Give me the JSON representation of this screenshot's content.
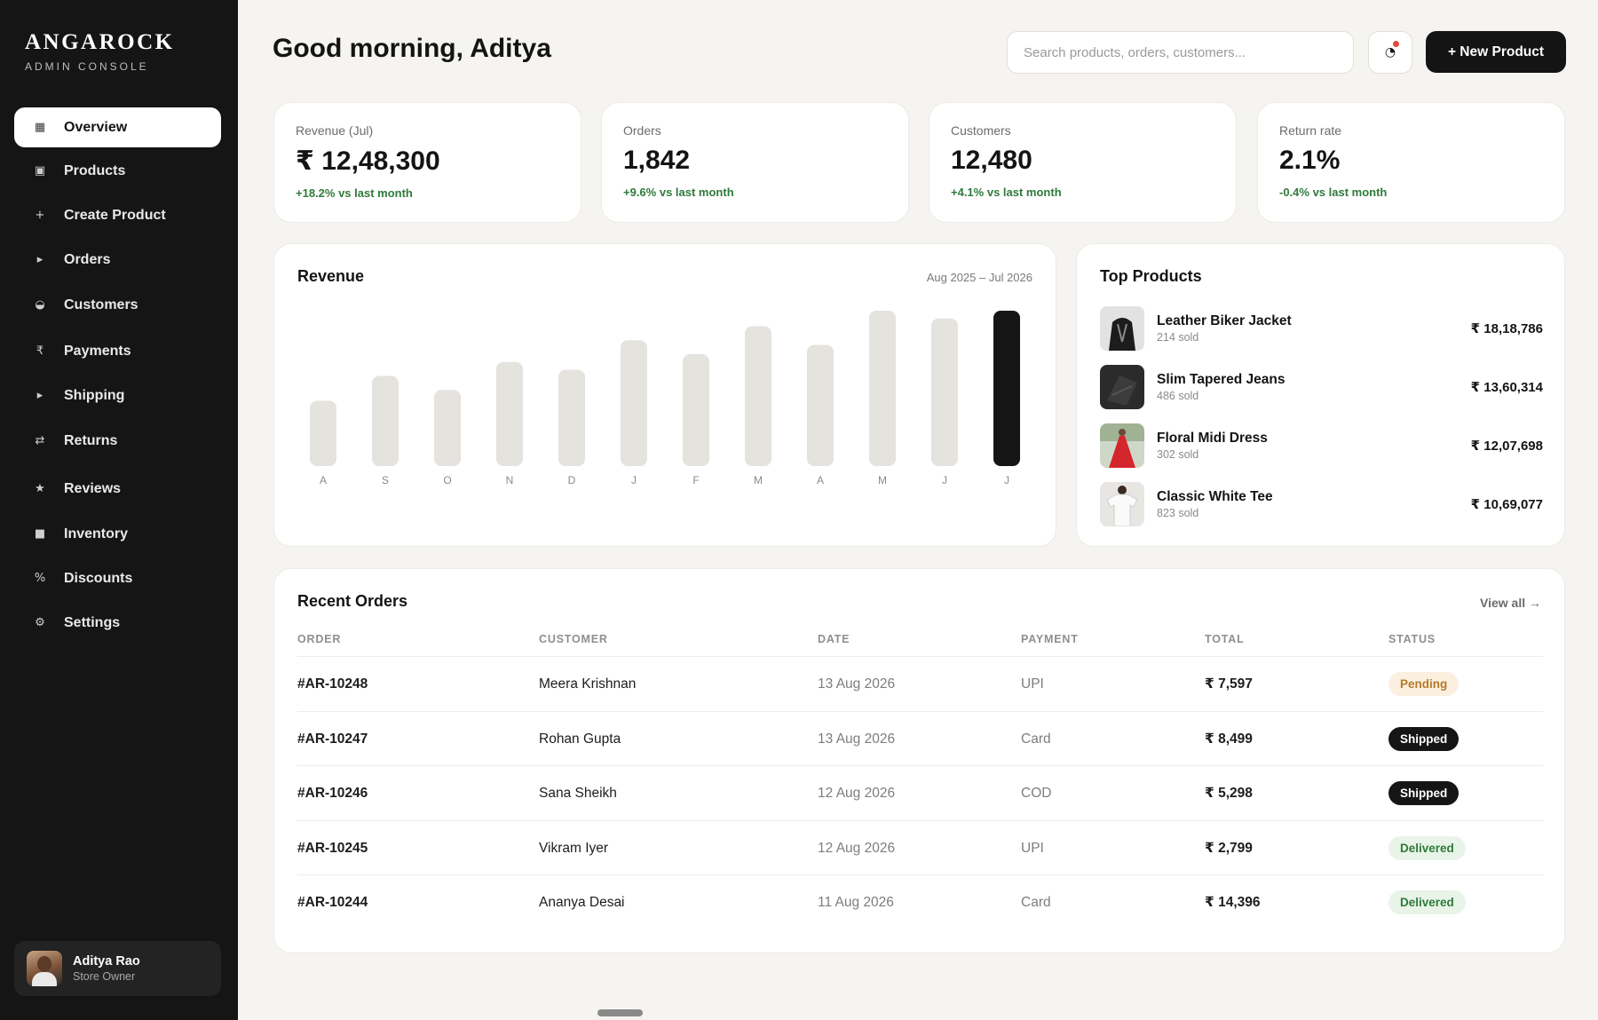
{
  "brand": {
    "name": "ANGAROCK",
    "subtitle": "ADMIN CONSOLE"
  },
  "sidebar": {
    "items": [
      {
        "label": "Overview",
        "icon": "grid-square-icon",
        "glyph": "▦",
        "active": true
      },
      {
        "label": "Products",
        "icon": "box-icon",
        "glyph": "▣"
      },
      {
        "label": "Create Product",
        "icon": "plus-icon",
        "glyph": "+"
      },
      {
        "label": "Orders",
        "icon": "caret-right-icon",
        "glyph": "▸"
      },
      {
        "label": "Customers",
        "icon": "half-circle-icon",
        "glyph": "◒"
      },
      {
        "label": "Payments",
        "icon": "rupee-icon",
        "glyph": "₹"
      },
      {
        "label": "Shipping",
        "icon": "caret-right-icon",
        "glyph": "▸"
      },
      {
        "label": "Returns",
        "icon": "swap-arrows-icon",
        "glyph": "⇄"
      },
      {
        "label": "Reviews",
        "icon": "star-icon",
        "glyph": "★"
      },
      {
        "label": "Inventory",
        "icon": "square-icon",
        "glyph": "■"
      },
      {
        "label": "Discounts",
        "icon": "percent-icon",
        "glyph": "%"
      },
      {
        "label": "Settings",
        "icon": "gear-icon",
        "glyph": "⚙"
      }
    ]
  },
  "user": {
    "name": "Aditya Rao",
    "role": "Store Owner"
  },
  "header": {
    "greeting": "Good morning, Aditya",
    "search_placeholder": "Search products, orders, customers...",
    "notification_glyph": "◔",
    "new_button": "+ New Product"
  },
  "kpis": [
    {
      "label": "Revenue (Jul)",
      "value": "₹ 12,48,300",
      "delta": "+18.2% vs last month"
    },
    {
      "label": "Orders",
      "value": "1,842",
      "delta": "+9.6% vs last month"
    },
    {
      "label": "Customers",
      "value": "12,480",
      "delta": "+4.1% vs last month"
    },
    {
      "label": "Return rate",
      "value": "2.1%",
      "delta": "-0.4% vs last month"
    }
  ],
  "revenue": {
    "title": "Revenue",
    "range": "Aug 2025 – Jul 2026"
  },
  "chart_data": {
    "type": "bar",
    "title": "Revenue",
    "categories": [
      "A",
      "S",
      "O",
      "N",
      "D",
      "J",
      "F",
      "M",
      "A",
      "M",
      "J",
      "J"
    ],
    "values": [
      42,
      58,
      49,
      67,
      62,
      81,
      72,
      90,
      78,
      100,
      95,
      100
    ],
    "ylim": [
      0,
      100
    ],
    "highlight_index": 11,
    "colors": {
      "bar": "#e5e3de",
      "highlight": "#151515",
      "tick": "#8a8a8a"
    },
    "grid": false
  },
  "top_products": {
    "title": "Top Products",
    "items": [
      {
        "name": "Leather Biker Jacket",
        "sold": "214 sold",
        "price": "₹ 18,18,786",
        "thumb": "jacket"
      },
      {
        "name": "Slim Tapered Jeans",
        "sold": "486 sold",
        "price": "₹ 13,60,314",
        "thumb": "jeans"
      },
      {
        "name": "Floral Midi Dress",
        "sold": "302 sold",
        "price": "₹ 12,07,698",
        "thumb": "dress"
      },
      {
        "name": "Classic White Tee",
        "sold": "823 sold",
        "price": "₹ 10,69,077",
        "thumb": "tee"
      }
    ]
  },
  "orders": {
    "title": "Recent Orders",
    "view_all": "View all →",
    "columns": [
      "ORDER",
      "CUSTOMER",
      "DATE",
      "PAYMENT",
      "TOTAL",
      "STATUS"
    ],
    "rows": [
      {
        "order": "#AR-10248",
        "customer": "Meera Krishnan",
        "date": "13 Aug 2026",
        "payment": "UPI",
        "total": "₹ 7,597",
        "status": "Pending"
      },
      {
        "order": "#AR-10247",
        "customer": "Rohan Gupta",
        "date": "13 Aug 2026",
        "payment": "Card",
        "total": "₹ 8,499",
        "status": "Shipped"
      },
      {
        "order": "#AR-10246",
        "customer": "Sana Sheikh",
        "date": "12 Aug 2026",
        "payment": "COD",
        "total": "₹ 5,298",
        "status": "Shipped"
      },
      {
        "order": "#AR-10245",
        "customer": "Vikram Iyer",
        "date": "12 Aug 2026",
        "payment": "UPI",
        "total": "₹ 2,799",
        "status": "Delivered"
      },
      {
        "order": "#AR-10244",
        "customer": "Ananya Desai",
        "date": "11 Aug 2026",
        "payment": "Card",
        "total": "₹ 14,396",
        "status": "Delivered"
      }
    ]
  }
}
